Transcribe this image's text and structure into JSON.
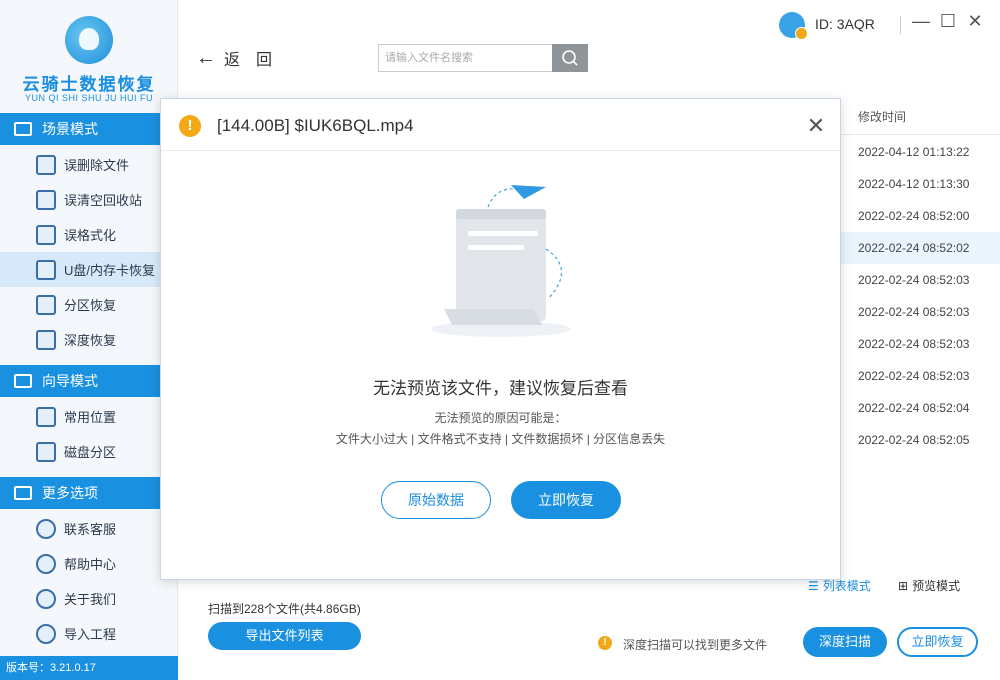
{
  "app": {
    "name": "云骑士数据恢复",
    "pinyin": "YUN QI SHI SHU JU HUI FU",
    "version": "版本号：3.21.0.17"
  },
  "sidebar": {
    "sections": [
      {
        "title": "场景模式",
        "items": [
          {
            "label": "误删除文件",
            "icon": "deleted-file-icon"
          },
          {
            "label": "误清空回收站",
            "icon": "recycle-bin-icon"
          },
          {
            "label": "误格式化",
            "icon": "format-disk-icon"
          },
          {
            "label": "U盘/内存卡恢复",
            "icon": "usb-card-icon",
            "active": true
          },
          {
            "label": "分区恢复",
            "icon": "partition-icon"
          },
          {
            "label": "深度恢复",
            "icon": "deep-recover-icon"
          }
        ]
      },
      {
        "title": "向导模式",
        "items": [
          {
            "label": "常用位置",
            "icon": "windows-location-icon"
          },
          {
            "label": "磁盘分区",
            "icon": "disk-partition-icon"
          }
        ]
      },
      {
        "title": "更多选项",
        "items": [
          {
            "label": "联系客服",
            "icon": "customer-service-icon"
          },
          {
            "label": "帮助中心",
            "icon": "help-icon"
          },
          {
            "label": "关于我们",
            "icon": "info-icon"
          },
          {
            "label": "导入工程",
            "icon": "import-project-icon"
          }
        ]
      }
    ]
  },
  "topbar": {
    "back_label": "返　回",
    "search_placeholder": "请输入文件名搜索",
    "user_id": "ID: 3AQR"
  },
  "list": {
    "column_header": "修改时间",
    "times": [
      "2022-04-12 01:13:22",
      "2022-04-12 01:13:30",
      "2022-02-24 08:52:00",
      "2022-02-24 08:52:02",
      "2022-02-24 08:52:03",
      "2022-02-24 08:52:03",
      "2022-02-24 08:52:03",
      "2022-02-24 08:52:03",
      "2022-02-24 08:52:04",
      "2022-02-24 08:52:05"
    ]
  },
  "bottom": {
    "scan_count": "扫描到228个文件(共4.86GB)",
    "export_label": "导出文件列表",
    "view_list": "列表模式",
    "view_preview": "预览模式",
    "hint": "深度扫描可以找到更多文件",
    "deep_scan": "深度扫描",
    "recover": "立即恢复"
  },
  "modal": {
    "title": "[144.00B] $IUK6BQL.mp4",
    "message": "无法预览该文件，建议恢复后查看",
    "reason_title": "无法预览的原因可能是：",
    "reasons": "文件大小过大 | 文件格式不支持 | 文件数据损坏 | 分区信息丢失",
    "raw_button": "原始数据",
    "recover_button": "立即恢复"
  }
}
